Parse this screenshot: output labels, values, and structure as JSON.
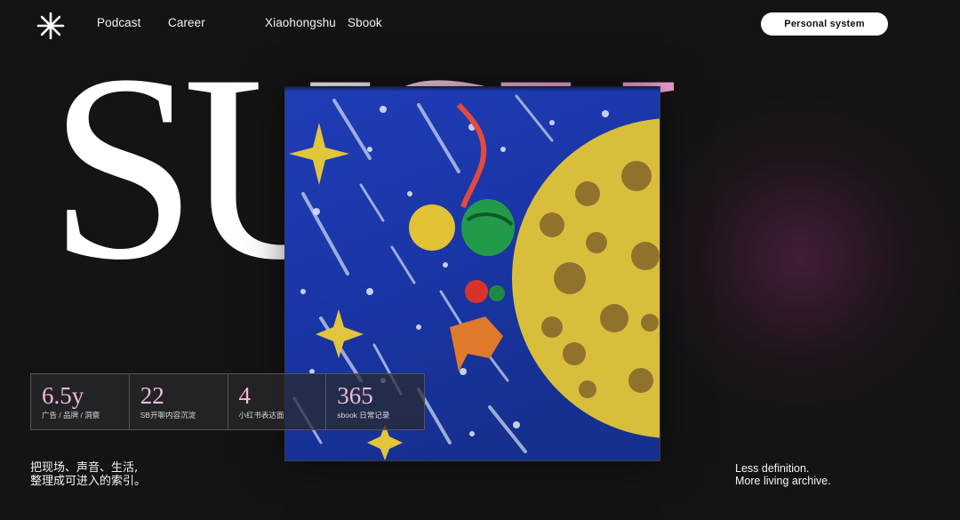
{
  "nav": {
    "logo_icon": "asterisk-logo-icon",
    "links": [
      {
        "label": "Podcast"
      },
      {
        "label": "Career"
      },
      {
        "label": "Xiaohongshu"
      },
      {
        "label": "Sbook"
      }
    ],
    "personal_button": "Personal system"
  },
  "hero": {
    "title": "SUSU",
    "colors": {
      "white": "#ffffff",
      "pink": "#f0a2d3",
      "stat_pink": "#f2b8d8"
    }
  },
  "artwork": {
    "icon": "starry-painting-artwork",
    "colors": {
      "sky": "#1a36a8",
      "moon": "#d9be3c",
      "crater": "#8a6a2c"
    }
  },
  "stats": [
    {
      "value": "6.5y",
      "label": "广告 / 品牌 / 洞察"
    },
    {
      "value": "22",
      "label": "SB开聊内容沉淀"
    },
    {
      "value": "4",
      "label": "小红书表达面"
    },
    {
      "value": "365",
      "label": "sbook 日常记录"
    }
  ],
  "tagline_left": {
    "line1": "把现场、声音、生活,",
    "line2": "整理成可进入的索引。"
  },
  "tagline_right": {
    "line1": "Less definition.",
    "line2": "More living archive."
  }
}
